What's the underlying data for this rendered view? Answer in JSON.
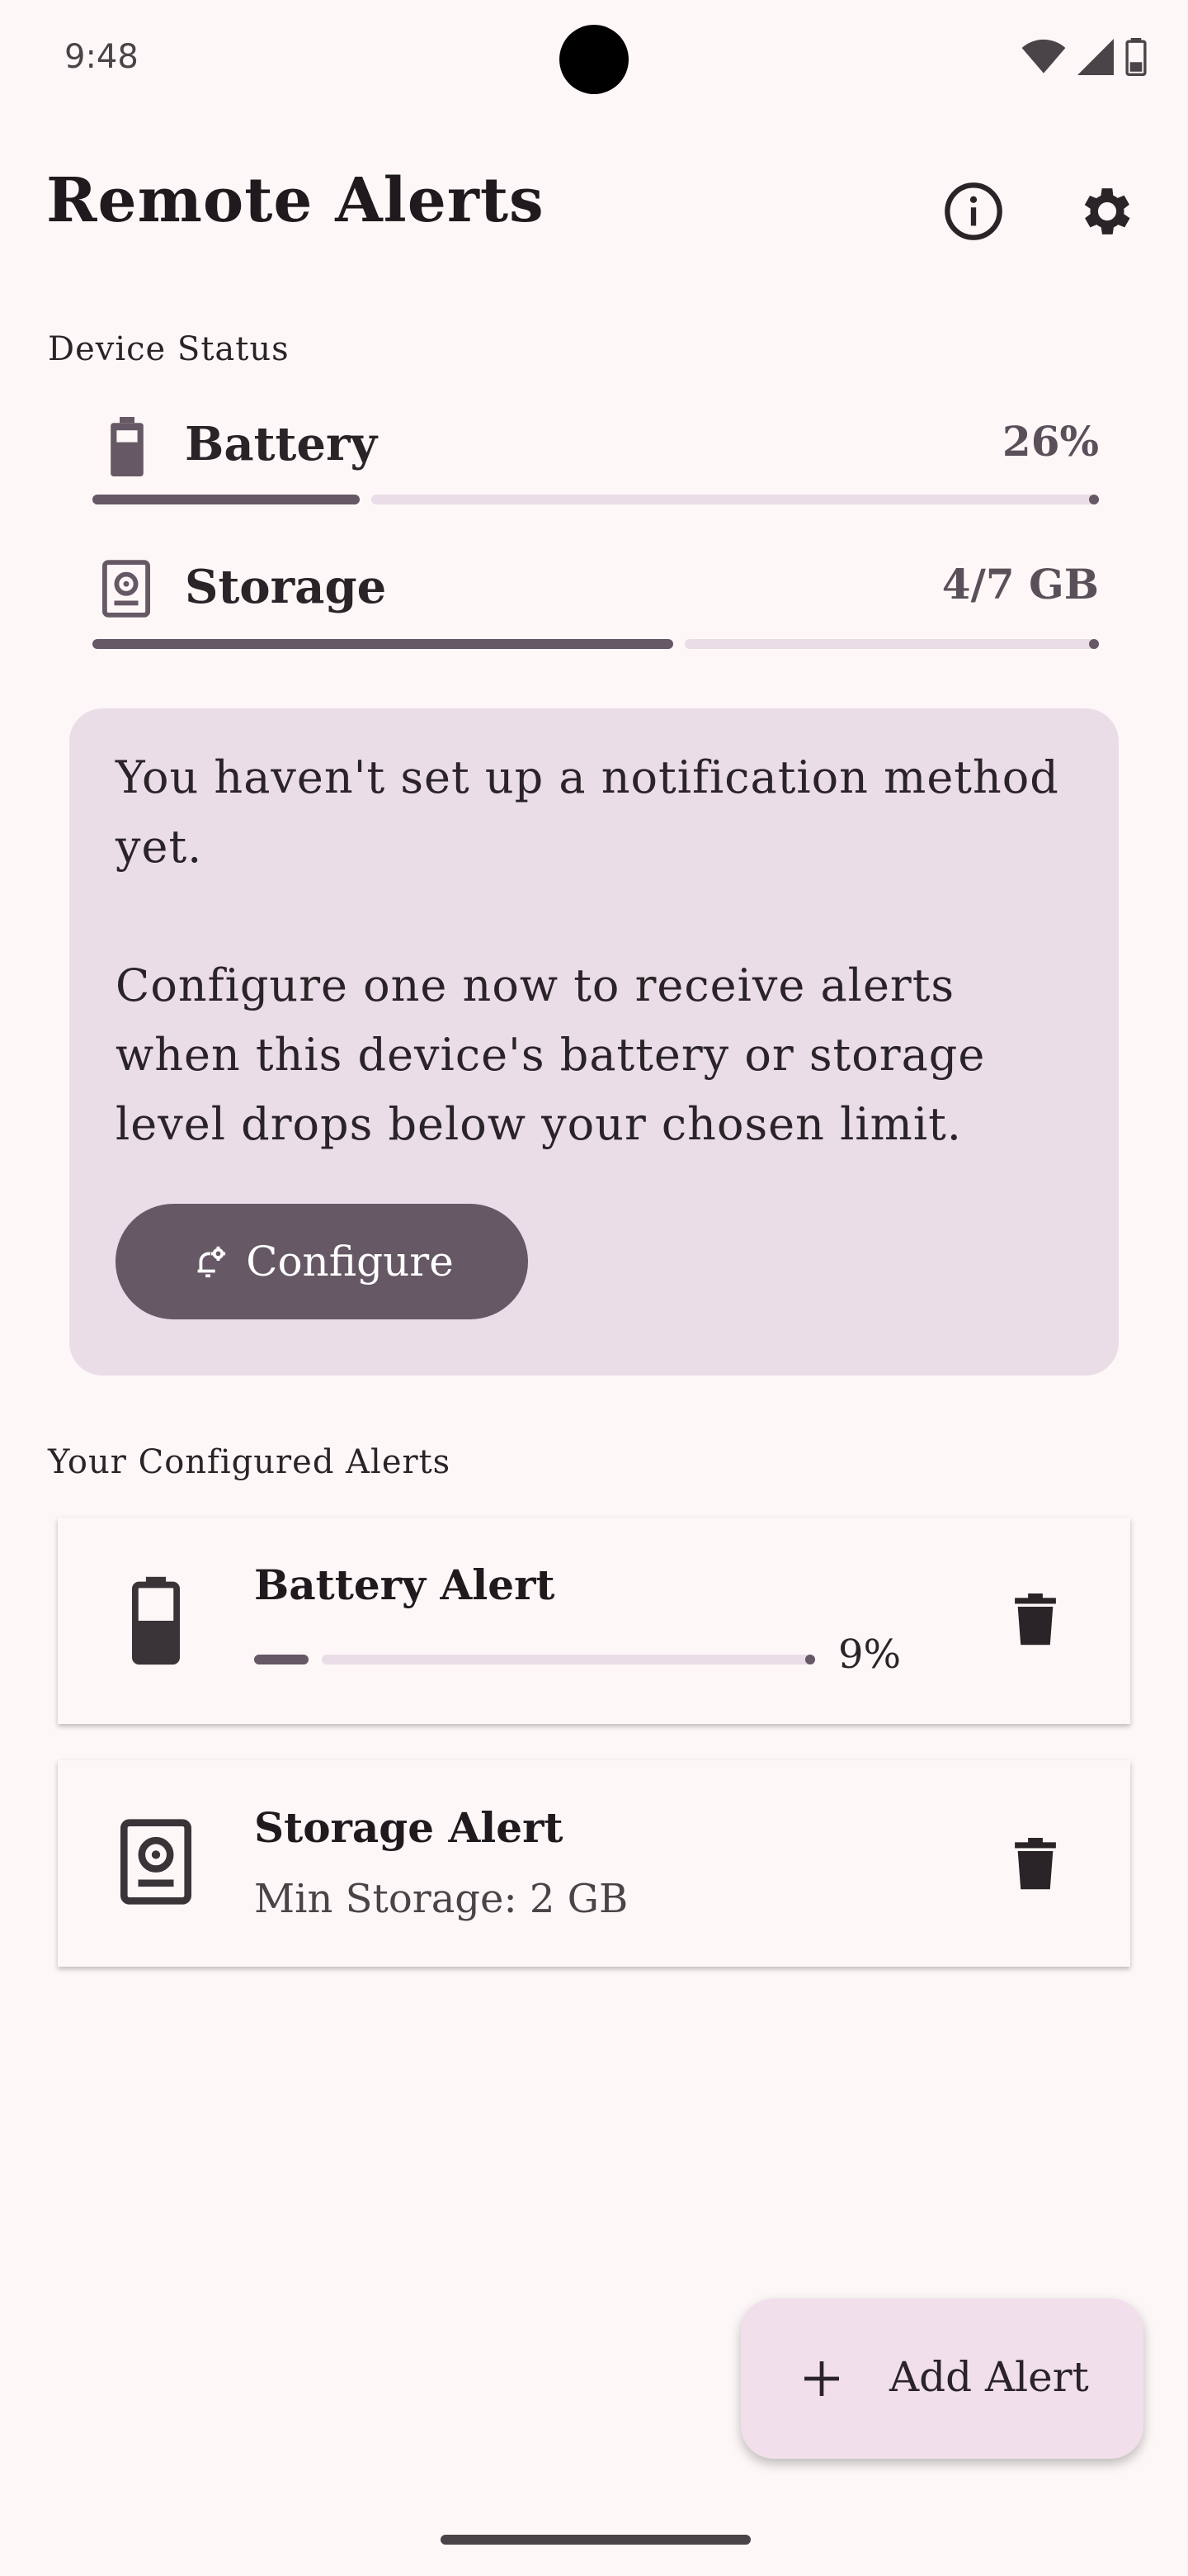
{
  "status_bar": {
    "time": "9:48"
  },
  "header": {
    "title": "Remote Alerts",
    "info_icon": "info-icon",
    "settings_icon": "gear-icon"
  },
  "device_status": {
    "label": "Device Status",
    "battery": {
      "label": "Battery",
      "value": "26%",
      "progress": 0.27
    },
    "storage": {
      "label": "Storage",
      "value": "4/7 GB",
      "progress": 0.58
    }
  },
  "notice": {
    "line1": "You haven't set up a notification method yet.",
    "line2": "Configure one now to receive alerts when this device's battery or storage level drops below your chosen limit.",
    "button": "Configure"
  },
  "alerts": {
    "label": "Your Configured Alerts",
    "battery_alert": {
      "title": "Battery Alert",
      "value": "9%",
      "progress": 0.09
    },
    "storage_alert": {
      "title": "Storage Alert",
      "subtitle": "Min Storage: 2 GB"
    }
  },
  "fab": {
    "label": "Add Alert"
  },
  "colors": {
    "accent": "#665865",
    "surface_variant": "#eadde7",
    "background": "#fdf8f7"
  }
}
